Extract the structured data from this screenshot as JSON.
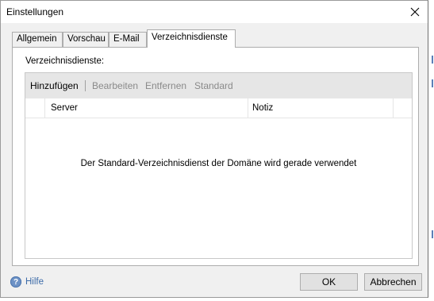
{
  "window": {
    "title": "Einstellungen"
  },
  "tabs": [
    {
      "label": "Allgemein",
      "active": false
    },
    {
      "label": "Vorschau",
      "active": false
    },
    {
      "label": "E-Mail",
      "active": false
    },
    {
      "label": "Verzeichnisdienste",
      "active": true
    }
  ],
  "panel": {
    "section_label": "Verzeichnisdienste:",
    "toolbar": {
      "add": "Hinzufügen",
      "edit": "Bearbeiten",
      "remove": "Entfernen",
      "default": "Standard"
    },
    "columns": [
      "Server",
      "Notiz"
    ],
    "empty_message": "Der Standard-Verzeichnisdienst der Domäne wird gerade verwendet"
  },
  "footer": {
    "help_label": "Hilfe",
    "ok_label": "OK",
    "cancel_label": "Abbrechen"
  },
  "icons": {
    "close": "close-icon",
    "help": "help-icon"
  },
  "colors": {
    "dialog_bg": "#f0f0f0",
    "toolbar_bg": "#e6e6e6",
    "disabled_text": "#8a8a8a",
    "link": "#3c6aa8"
  }
}
